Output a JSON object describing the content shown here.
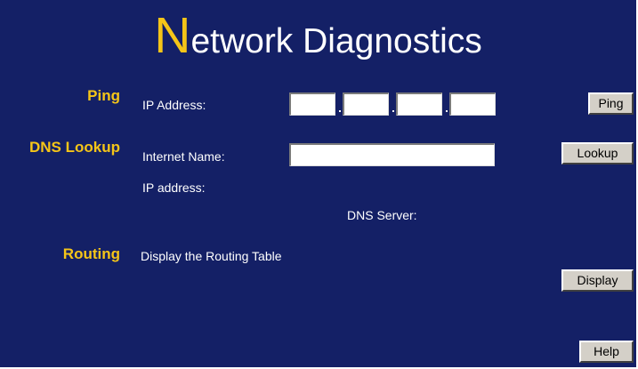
{
  "page": {
    "title_initial": "N",
    "title_rest": "etwork Diagnostics"
  },
  "ping": {
    "section_label": "Ping",
    "ip_label": "IP Address:",
    "octets": [
      "",
      "",
      "",
      ""
    ],
    "button_label": "Ping"
  },
  "dns": {
    "section_label": "DNS Lookup",
    "name_label": "Internet Name:",
    "name_value": "",
    "ip_label": "IP address:",
    "server_label": "DNS Server:",
    "button_label": "Lookup"
  },
  "routing": {
    "section_label": "Routing",
    "description": "Display the Routing Table",
    "button_label": "Display"
  },
  "help": {
    "button_label": "Help"
  },
  "colors": {
    "background": "#142066",
    "accent": "#f5c518",
    "text": "#ffffff",
    "button_face": "#d4d0c8"
  }
}
